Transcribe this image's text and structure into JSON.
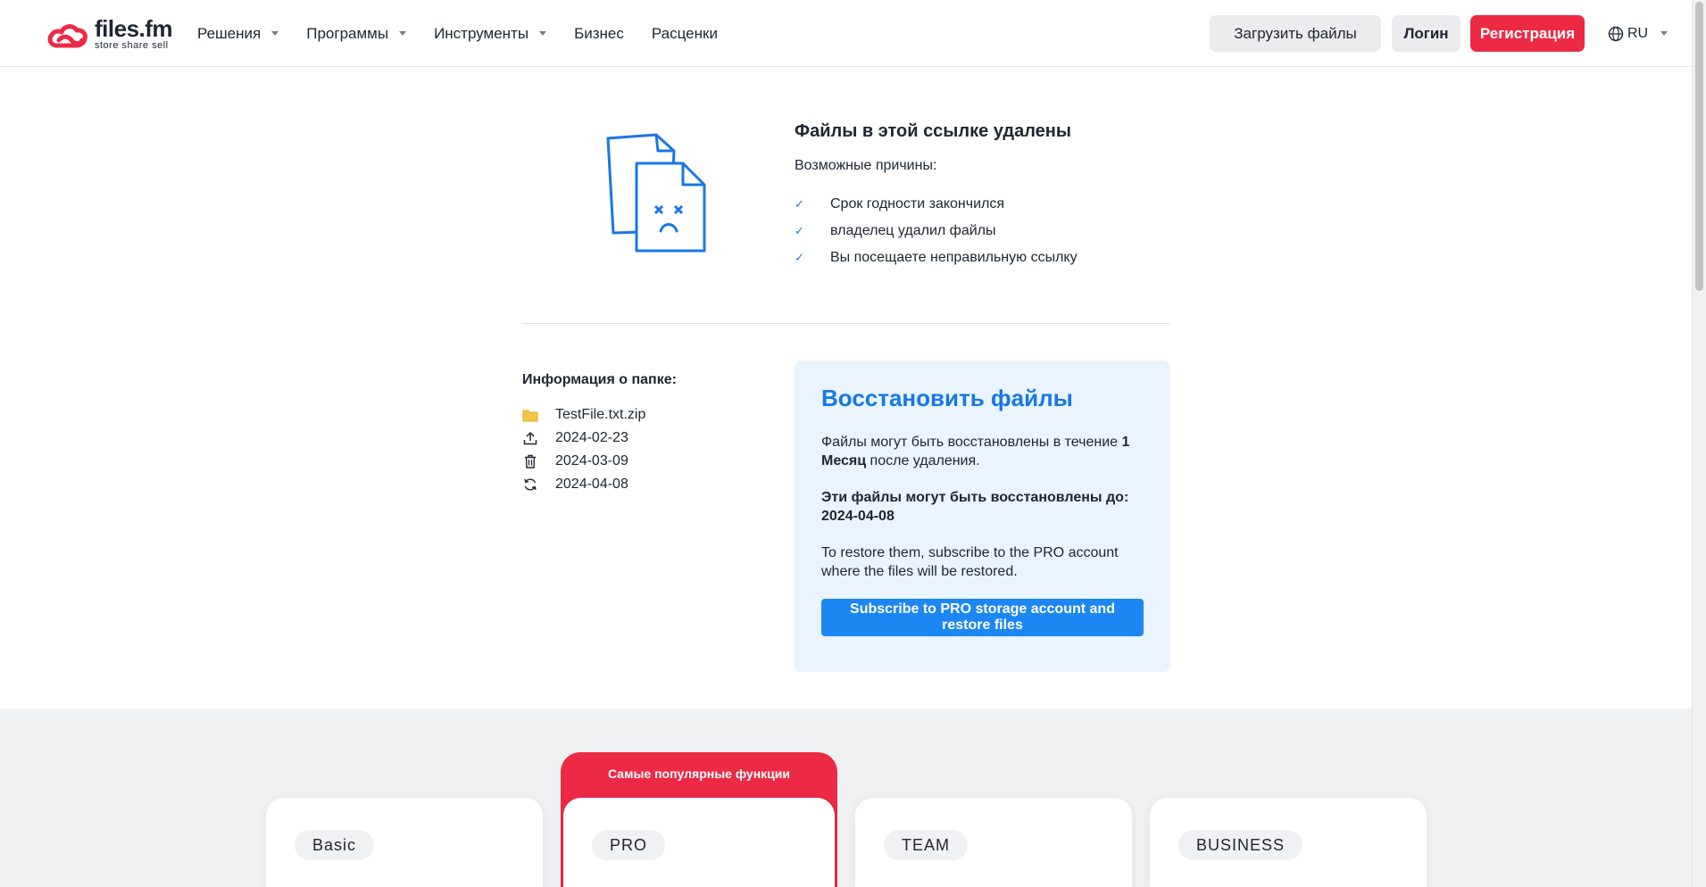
{
  "header": {
    "logo": {
      "name": "files.fm",
      "tagline": "store share sell"
    },
    "nav": [
      {
        "label": "Решения",
        "dropdown": true
      },
      {
        "label": "Программы",
        "dropdown": true
      },
      {
        "label": "Инструменты",
        "dropdown": true
      },
      {
        "label": "Бизнес",
        "dropdown": false
      },
      {
        "label": "Расценки",
        "dropdown": false
      }
    ],
    "upload_label": "Загрузить файлы",
    "login_label": "Логин",
    "register_label": "Регистрация",
    "language": "RU"
  },
  "deleted": {
    "title": "Файлы в этой ссылке удалены",
    "subtitle": "Возможные причины:",
    "reasons": [
      "Срок годности закончился",
      "владелец удалил файлы",
      "Вы посещаете неправильную ссылку"
    ]
  },
  "folder_info": {
    "title": "Информация о папке:",
    "file_name": "TestFile.txt.zip",
    "uploaded": "2024-02-23",
    "deleted": "2024-03-09",
    "restorable_until": "2024-04-08"
  },
  "restore": {
    "title": "Восстановить файлы",
    "p1_before": "Файлы могут быть восстановлены в течение ",
    "p1_bold": "1 Месяц",
    "p1_after": " после удаления.",
    "p2": "Эти файлы могут быть восстановлены до: 2024-04-08",
    "p3": "To restore them, subscribe to the PRO account where the files will be restored.",
    "button_label": "Subscribe to PRO storage account and restore files"
  },
  "pricing": {
    "popular_label": "Самые популярные функции",
    "plans": [
      "Basic",
      "PRO",
      "TEAM",
      "BUSINESS"
    ]
  },
  "colors": {
    "brand_red": "#ec2a45",
    "accent_blue": "#1877e6",
    "restore_bg": "#e9f4fe"
  }
}
